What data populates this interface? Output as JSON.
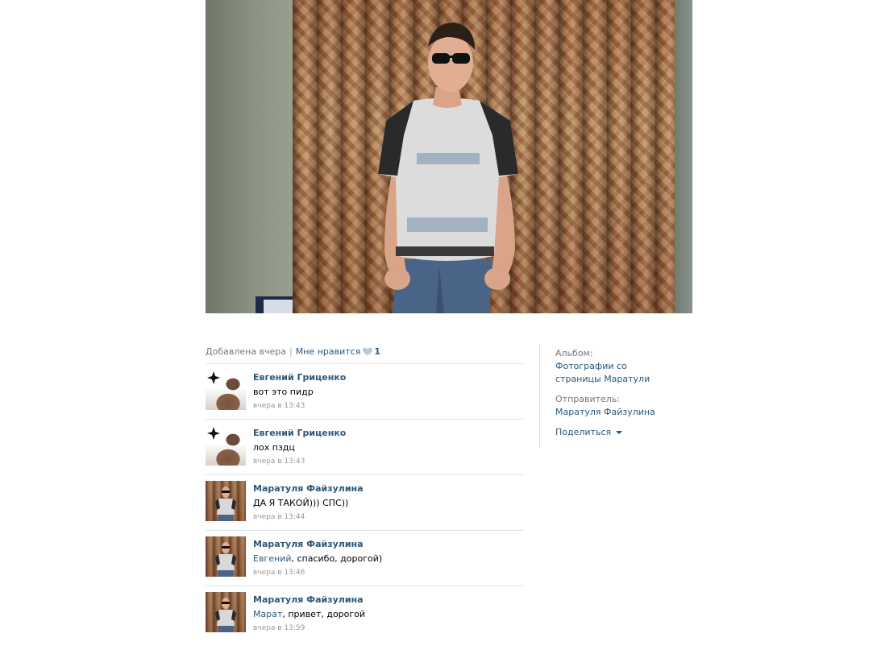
{
  "photo": {
    "subject": "photo"
  },
  "meta": {
    "added": "Добавлена вчера",
    "like_label": "Мне нравится",
    "like_count": "1"
  },
  "comments": [
    {
      "author": "Евгений Гриценко",
      "mention": "",
      "text": "вот это пидр",
      "time": "вчера в 13:43",
      "avatar": "tattoo-avatar"
    },
    {
      "author": "Евгений Гриценко",
      "mention": "",
      "text": "лох пздц",
      "time": "вчера в 13:43",
      "avatar": "tattoo-avatar"
    },
    {
      "author": "Маратуля Файзулина",
      "mention": "",
      "text": "ДА Я ТАКОЙ))) СПС))",
      "time": "вчера в 13:44",
      "avatar": "curtain-avatar"
    },
    {
      "author": "Маратуля Файзулина",
      "mention": "Евгений",
      "text": ", спасибо, дорогой)",
      "time": "вчера в 13:46",
      "avatar": "curtain-avatar"
    },
    {
      "author": "Маратуля Файзулина",
      "mention": "Марат",
      "text": ", привет, дорогой",
      "time": "вчера в 13:59",
      "avatar": "curtain-avatar"
    }
  ],
  "info": {
    "album_label": "Альбом:",
    "album_value": "Фотографии со страницы Маратули",
    "sender_label": "Отправитель:",
    "sender_value": "Маратуля Файзулина",
    "share_label": "Поделиться"
  },
  "colors": {
    "link": "#2b587a",
    "muted": "#777777",
    "divider": "#dae1e8"
  }
}
